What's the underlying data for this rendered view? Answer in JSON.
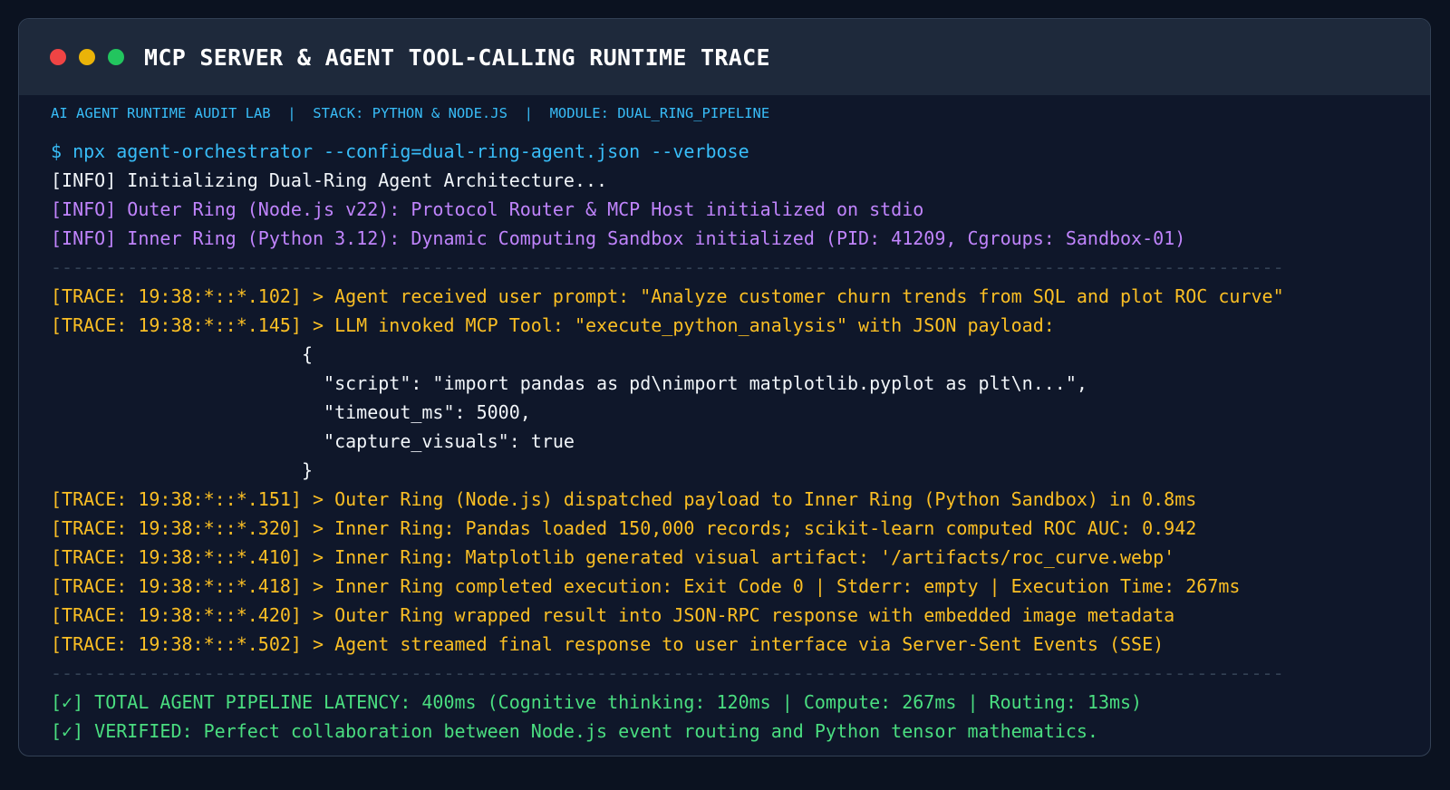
{
  "window": {
    "title": "MCP SERVER & AGENT TOOL-CALLING RUNTIME TRACE",
    "controls": [
      "close-dot",
      "minimize-dot",
      "maximize-dot"
    ],
    "control_colors": [
      "#ef4444",
      "#eab308",
      "#22c55e"
    ]
  },
  "meta_line": "AI AGENT RUNTIME AUDIT LAB  |  STACK: PYTHON & NODE.JS  |  MODULE: DUAL_RING_PIPELINE",
  "colors": {
    "background": "#0f172a",
    "titlebar": "#1e293b",
    "command": "#38bdf8",
    "info_purple": "#c084fc",
    "trace": "#fbbf24",
    "success": "#4ade80"
  },
  "console": {
    "command": "$ npx agent-orchestrator --config=dual-ring-agent.json --verbose",
    "info_init": "[INFO] Initializing Dual-Ring Agent Architecture...",
    "info_outer": "[INFO] Outer Ring (Node.js v22): Protocol Router & MCP Host initialized on stdio",
    "info_inner": "[INFO] Inner Ring (Python 3.12): Dynamic Computing Sandbox initialized (PID: 41209, Cgroups: Sandbox-01)",
    "separator": "-----------------------------------------------------------------------------------------------------------------",
    "trace_1": "[TRACE: 19:38:*::*.102] > Agent received user prompt: \"Analyze customer churn trends from SQL and plot ROC curve\"",
    "trace_2": "[TRACE: 19:38:*::*.145] > LLM invoked MCP Tool: \"execute_python_analysis\" with JSON payload:",
    "json_open": "                       {",
    "json_script": "                         \"script\": \"import pandas as pd\\nimport matplotlib.pyplot as plt\\n...\",",
    "json_timeout": "                         \"timeout_ms\": 5000,",
    "json_capture": "                         \"capture_visuals\": true",
    "json_close": "                       }",
    "trace_3": "[TRACE: 19:38:*::*.151] > Outer Ring (Node.js) dispatched payload to Inner Ring (Python Sandbox) in 0.8ms",
    "trace_4": "[TRACE: 19:38:*::*.320] > Inner Ring: Pandas loaded 150,000 records; scikit-learn computed ROC AUC: 0.942",
    "trace_5": "[TRACE: 19:38:*::*.410] > Inner Ring: Matplotlib generated visual artifact: '/artifacts/roc_curve.webp'",
    "trace_6": "[TRACE: 19:38:*::*.418] > Inner Ring completed execution: Exit Code 0 | Stderr: empty | Execution Time: 267ms",
    "trace_7": "[TRACE: 19:38:*::*.420] > Outer Ring wrapped result into JSON-RPC response with embedded image metadata",
    "trace_8": "[TRACE: 19:38:*::*.502] > Agent streamed final response to user interface via Server-Sent Events (SSE)",
    "summary_latency": "[✓] TOTAL AGENT PIPELINE LATENCY: 400ms (Cognitive thinking: 120ms | Compute: 267ms | Routing: 13ms)",
    "summary_verified": "[✓] VERIFIED: Perfect collaboration between Node.js event routing and Python tensor mathematics."
  }
}
